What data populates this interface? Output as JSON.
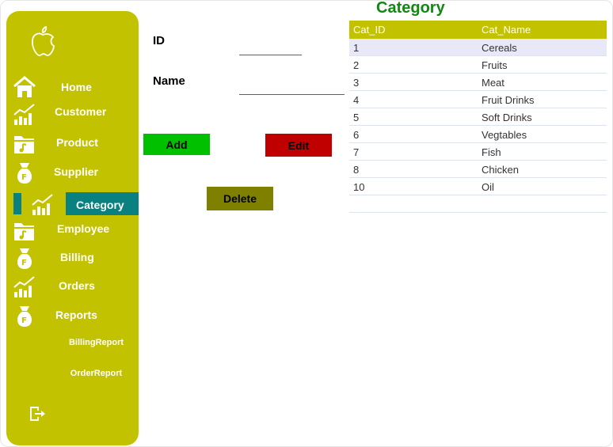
{
  "form": {
    "id_label": "ID",
    "name_label": "Name",
    "id_value": "",
    "name_value": "",
    "add_label": "Add",
    "edit_label": "Edit",
    "delete_label": "Delete"
  },
  "nav": {
    "items": [
      {
        "label": "Home",
        "icon": "home-icon"
      },
      {
        "label": "Customer",
        "icon": "chart-icon"
      },
      {
        "label": "Product",
        "icon": "music-folder-icon"
      },
      {
        "label": "Supplier",
        "icon": "money-bag-icon"
      },
      {
        "label": "Category",
        "icon": "chart-icon"
      },
      {
        "label": "Employee",
        "icon": "music-folder-icon"
      },
      {
        "label": "Billing",
        "icon": "money-bag-icon"
      },
      {
        "label": "Orders",
        "icon": "chart-icon"
      },
      {
        "label": "Reports",
        "icon": "money-bag-icon"
      }
    ],
    "sub_items": [
      {
        "label": "BillingReport"
      },
      {
        "label": "OrderReport"
      }
    ],
    "active": "Category"
  },
  "table": {
    "title": "Category",
    "columns": [
      "Cat_ID",
      "Cat_Name"
    ],
    "rows": [
      {
        "id": "1",
        "name": "Cereals"
      },
      {
        "id": "2",
        "name": "Fruits"
      },
      {
        "id": "3",
        "name": "Meat"
      },
      {
        "id": "4",
        "name": "Fruit Drinks"
      },
      {
        "id": "5",
        "name": "Soft Drinks"
      },
      {
        "id": "6",
        "name": "Vegtables"
      },
      {
        "id": "7",
        "name": "Fish"
      },
      {
        "id": "8",
        "name": "Chicken"
      },
      {
        "id": "10",
        "name": "Oil"
      }
    ]
  },
  "colors": {
    "sidebar": "#c2c200",
    "active": "#0a8080",
    "add": "#00c000",
    "edit": "#c00000",
    "delete": "#808000",
    "title": "#118811"
  }
}
